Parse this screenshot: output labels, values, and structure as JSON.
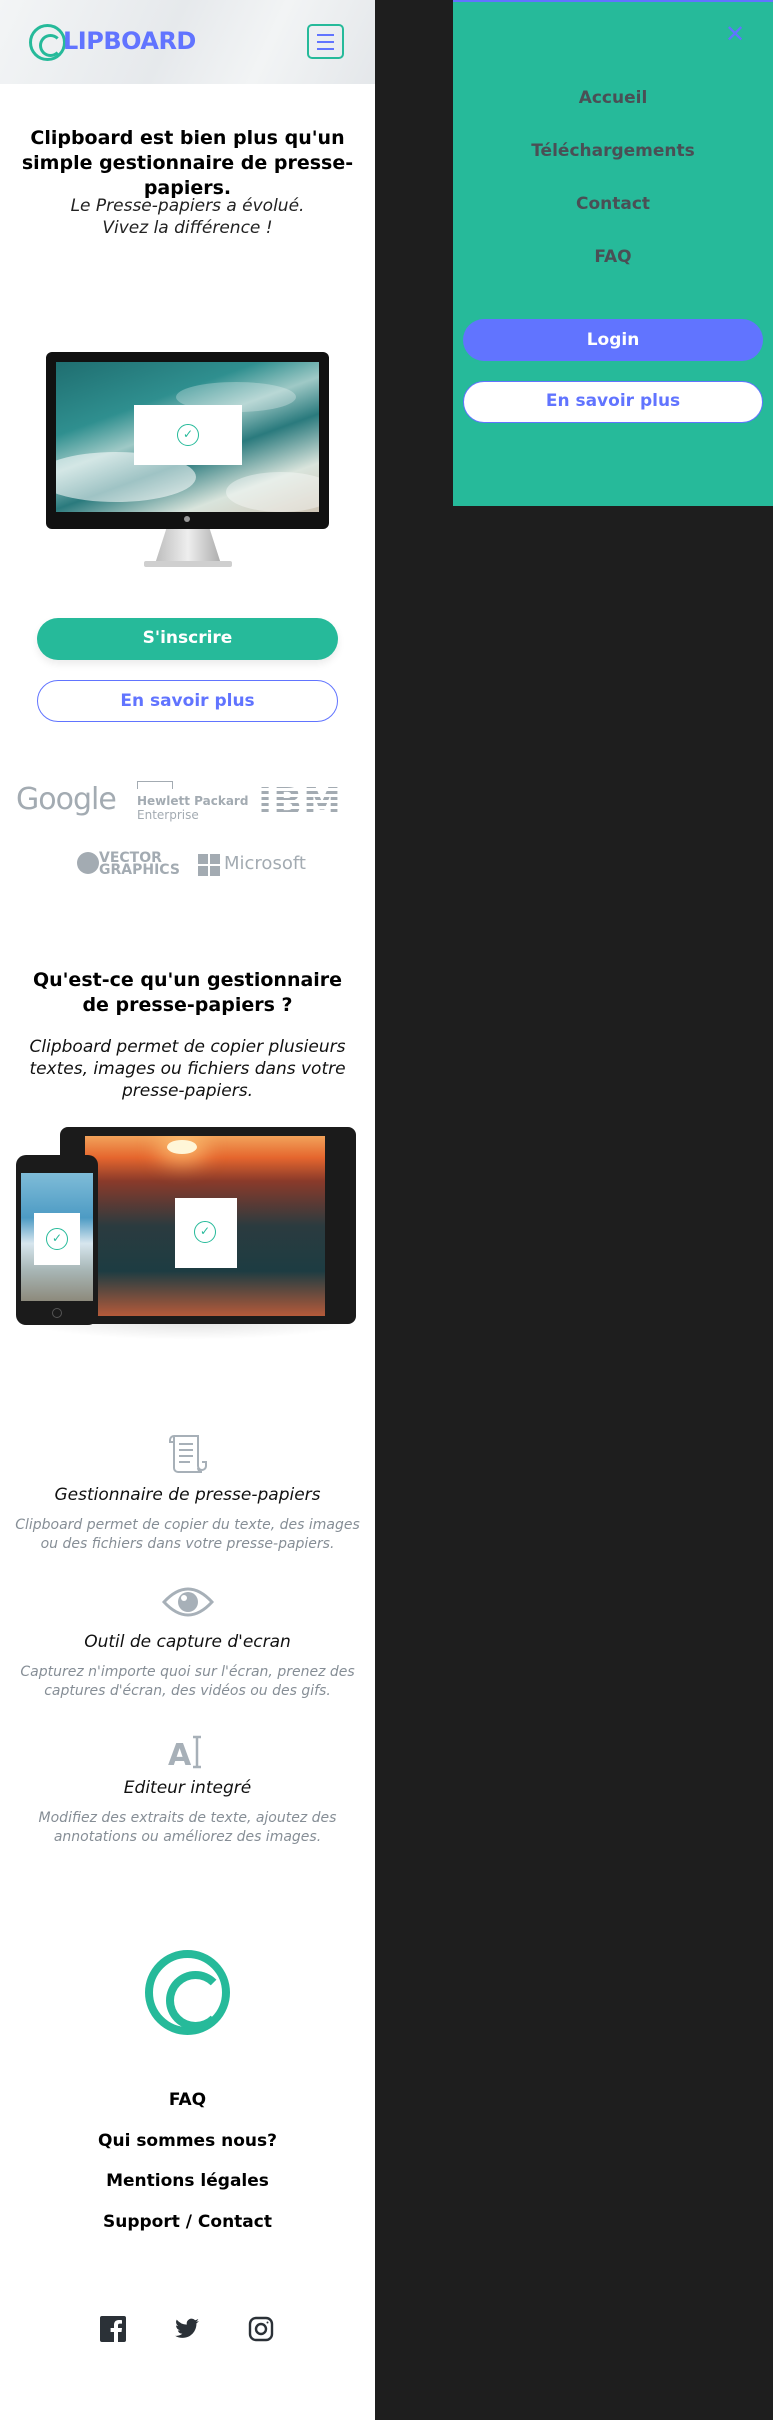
{
  "header": {
    "logo_text": "LIPBOARD"
  },
  "hero": {
    "title": "Clipboard est bien plus qu'un simple gestionnaire de presse-papiers.",
    "subtitle_line1": "Le Presse-papiers a évolué.",
    "subtitle_line2": "Vivez la différence !",
    "signup_label": "S'inscrire",
    "more_label": "En savoir plus"
  },
  "partners": {
    "google": "Google",
    "hp_line1": "Hewlett Packard",
    "hp_line2": "Enterprise",
    "ibm": "IBM",
    "vector_line1": "VECTOR",
    "vector_line2": "GRAPHICS",
    "microsoft": "Microsoft"
  },
  "what": {
    "title": "Qu'est-ce qu'un gestionnaire de presse-papiers ?",
    "subtitle": "Clipboard permet de copier plusieurs textes, images ou fichiers dans votre presse-papiers."
  },
  "features": [
    {
      "icon": "scroll-icon",
      "title": "Gestionnaire de presse-papiers",
      "desc": "Clipboard permet de copier du texte, des images ou des fichiers dans votre presse-papiers."
    },
    {
      "icon": "eye-icon",
      "title": "Outil de capture d'ecran",
      "desc": "Capturez n'importe quoi sur l'écran, prenez des captures d'écran, des vidéos ou des gifs."
    },
    {
      "icon": "text-cursor-icon",
      "title": "Editeur integré",
      "desc": "Modifiez des extraits de texte, ajoutez des annotations ou améliorez des images.",
      "glyph": "A"
    }
  ],
  "footer": {
    "links": [
      "FAQ",
      "Qui sommes nous?",
      "Mentions légales",
      "Support / Contact"
    ],
    "social": [
      "facebook-icon",
      "twitter-icon",
      "instagram-icon"
    ]
  },
  "menu": {
    "items": [
      "Accueil",
      "Téléchargements",
      "Contact",
      "FAQ"
    ],
    "login_label": "Login",
    "more_label": "En savoir plus"
  },
  "colors": {
    "accent_green": "#26ba9a",
    "accent_blue": "#6174ff",
    "backdrop": "#1e1e1e"
  }
}
